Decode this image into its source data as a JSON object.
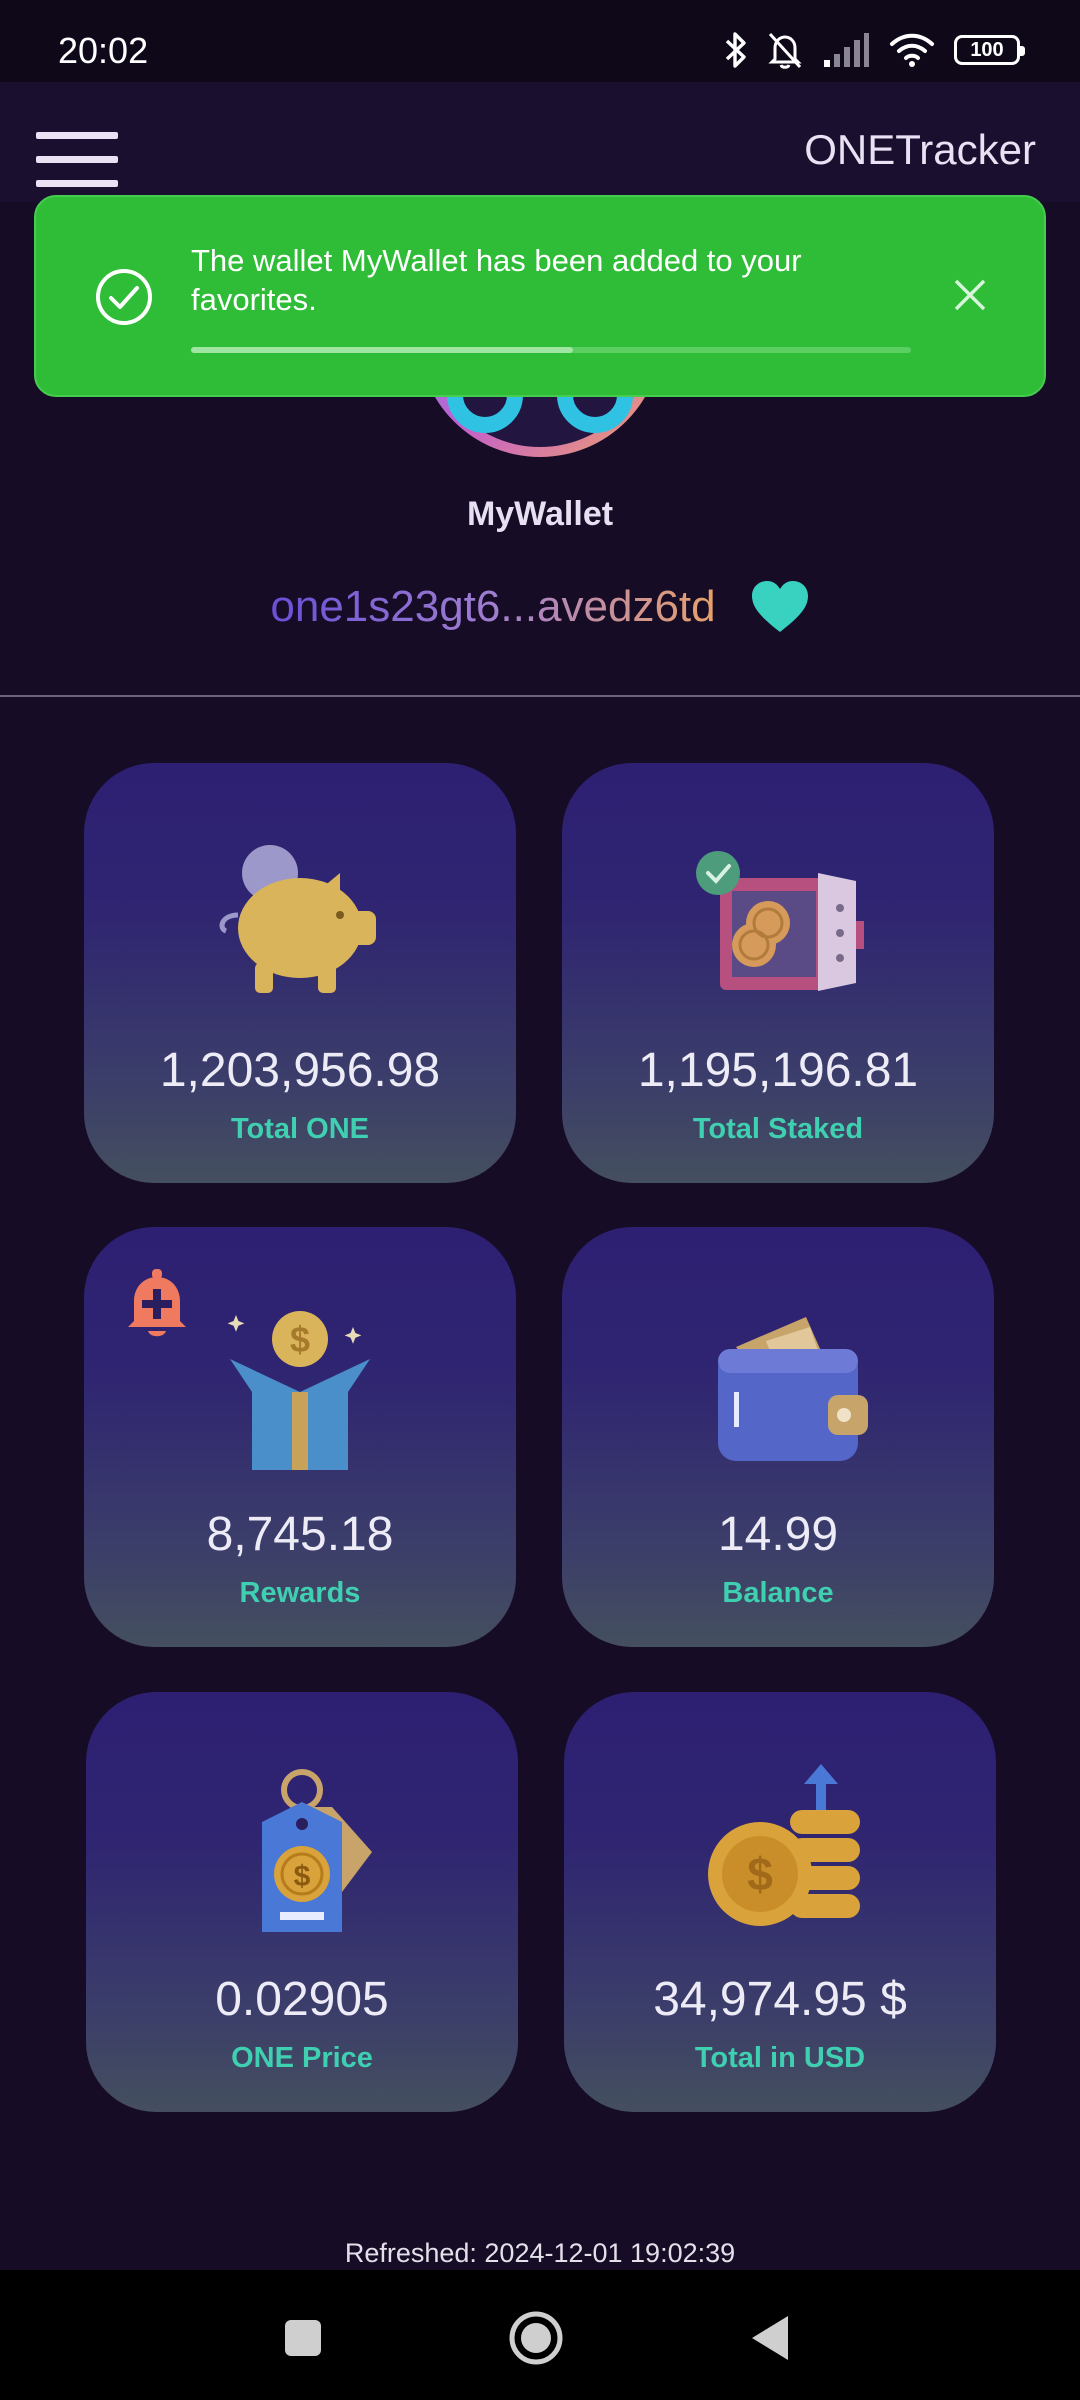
{
  "status_bar": {
    "time": "20:02",
    "battery": "100",
    "icons": [
      "bluetooth-icon",
      "bell-muted-icon",
      "signal-icon",
      "wifi-icon",
      "battery-icon"
    ]
  },
  "app_bar": {
    "title": "ONETracker",
    "menu_icon": "hamburger-menu-icon"
  },
  "toast": {
    "message": "The wallet MyWallet has been added to your favorites.",
    "icon": "check-circle-icon",
    "close_icon": "close-icon",
    "progress": 0.53,
    "color": "#2fbd38"
  },
  "wallet": {
    "name": "MyWallet",
    "address": "one1s23gt6...avedz6td",
    "favorite_icon": "heart-icon",
    "favorite_color": "#39d1c0"
  },
  "cards": [
    {
      "value": "1,203,956.98",
      "label": "Total ONE",
      "icon": "piggy-bank-icon"
    },
    {
      "value": "1,195,196.81",
      "label": "Total Staked",
      "icon": "safe-icon"
    },
    {
      "value": "8,745.18",
      "label": "Rewards",
      "icon": "gift-box-icon",
      "extra_icon": "bell-plus-icon"
    },
    {
      "value": "14.99",
      "label": "Balance",
      "icon": "wallet-icon"
    },
    {
      "value": "0.02905",
      "label": "ONE Price",
      "icon": "price-tag-icon"
    },
    {
      "value": "34,974.95 $",
      "label": "Total in USD",
      "icon": "coin-stack-icon"
    }
  ],
  "footer": {
    "refreshed": "Refreshed: 2024-12-01 19:02:39"
  },
  "nav": {
    "recents_icon": "square-icon",
    "home_icon": "circle-icon",
    "back_icon": "triangle-back-icon"
  },
  "colors": {
    "background": "#160c25",
    "accent": "#3fcfb1",
    "card_top": "#2d1f72",
    "card_bottom": "#444f5f"
  }
}
